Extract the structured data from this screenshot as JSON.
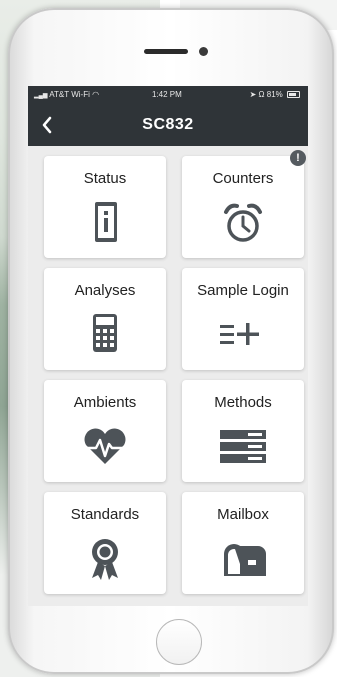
{
  "status_bar": {
    "carrier": "AT&T Wi-Fi",
    "time": "1:42 PM",
    "battery": "81%"
  },
  "nav": {
    "title": "SC832",
    "back_icon": "chevron-left-icon"
  },
  "colors": {
    "nav_bg": "#2f3438",
    "icon": "#4d5358",
    "tile_bg": "#ffffff",
    "screen_bg": "#ececec"
  },
  "tiles": [
    {
      "label": "Status",
      "icon": "info-document-icon"
    },
    {
      "label": "Counters",
      "icon": "alarm-clock-icon",
      "badge": "!"
    },
    {
      "label": "Analyses",
      "icon": "calculator-icon"
    },
    {
      "label": "Sample Login",
      "icon": "list-add-icon"
    },
    {
      "label": "Ambients",
      "icon": "heartbeat-icon"
    },
    {
      "label": "Methods",
      "icon": "server-rack-icon"
    },
    {
      "label": "Standards",
      "icon": "award-ribbon-icon"
    },
    {
      "label": "Mailbox",
      "icon": "mailbox-icon"
    }
  ]
}
